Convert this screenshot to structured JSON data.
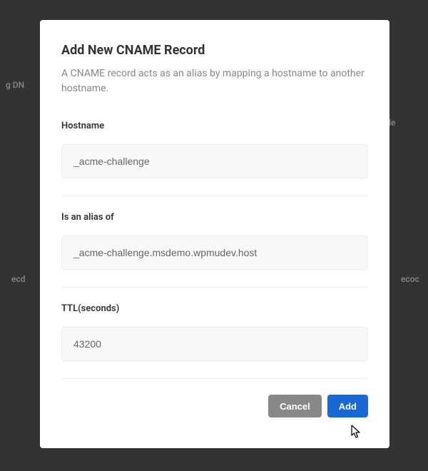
{
  "modal": {
    "title": "Add New CNAME Record",
    "description": "A CNAME record acts as an alias by mapping a hostname to another hostname."
  },
  "fields": {
    "hostname": {
      "label": "Hostname",
      "value": "_acme-challenge"
    },
    "alias": {
      "label": "Is an alias of",
      "value": "_acme-challenge.msdemo.wpmudev.host"
    },
    "ttl": {
      "label": "TTL(seconds)",
      "value": "43200"
    }
  },
  "actions": {
    "cancel": "Cancel",
    "add": "Add"
  },
  "background_hints": {
    "bg1": "g DN",
    "bg2": "le",
    "bg3": "ecd",
    "bg4": "ecoc"
  }
}
